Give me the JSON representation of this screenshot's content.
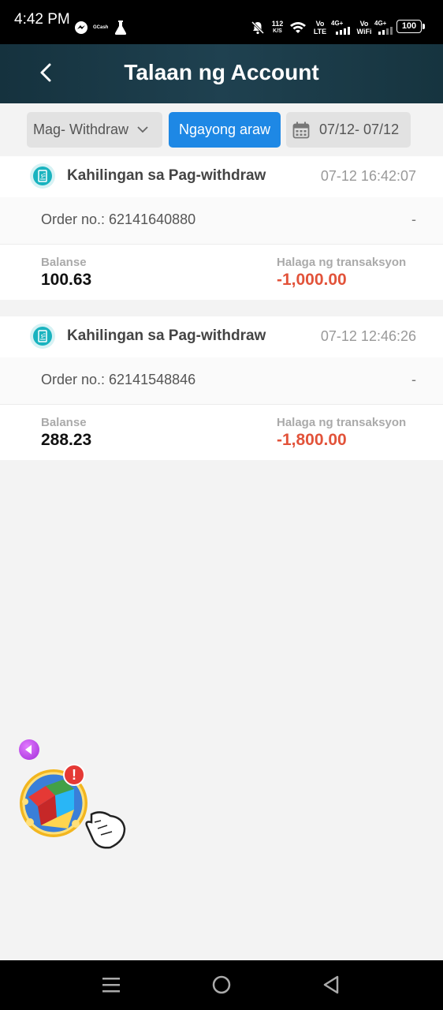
{
  "status_bar": {
    "time": "4:42 PM",
    "app_label": "GCash",
    "speed_value": "112",
    "speed_unit": "K/S",
    "vo_lte_top": "Vo",
    "vo_lte_bottom": "LTE",
    "vo_wifi_top": "Vo",
    "vo_wifi_bottom": "WiFi",
    "network_1": "4G+",
    "network_2": "4G+",
    "battery": "100"
  },
  "header": {
    "title": "Talaan ng Account"
  },
  "filters": {
    "type_select": "Mag- Withdraw",
    "today_label": "Ngayong araw",
    "date_range": "07/12- 07/12"
  },
  "records": [
    {
      "title": "Kahilingan sa Pag-withdraw",
      "time": "07-12 16:42:07",
      "order": "Order no.: 62141640880",
      "dash": "-",
      "balance_label": "Balanse",
      "balance": "100.63",
      "amount_label": "Halaga ng transaksyon",
      "amount": "-1,000.00"
    },
    {
      "title": "Kahilingan sa Pag-withdraw",
      "time": "07-12 12:46:26",
      "order": "Order no.: 62141548846",
      "dash": "-",
      "balance_label": "Balanse",
      "balance": "288.23",
      "amount_label": "Halaga ng transaksyon",
      "amount": "-1,800.00"
    }
  ],
  "floating_widget": {
    "badge": "!"
  },
  "colors": {
    "header_bg": "#1f4150",
    "accent_blue": "#1e88e5",
    "negative_red": "#e2533a",
    "record_icon": "#19b3bf"
  },
  "icons": {
    "back": "chevron-left-icon",
    "dropdown": "chevron-down-icon",
    "calendar": "calendar-icon",
    "record": "receipt-icon",
    "nav_menu": "menu-icon",
    "nav_home": "home-icon",
    "nav_back": "back-triangle-icon"
  }
}
